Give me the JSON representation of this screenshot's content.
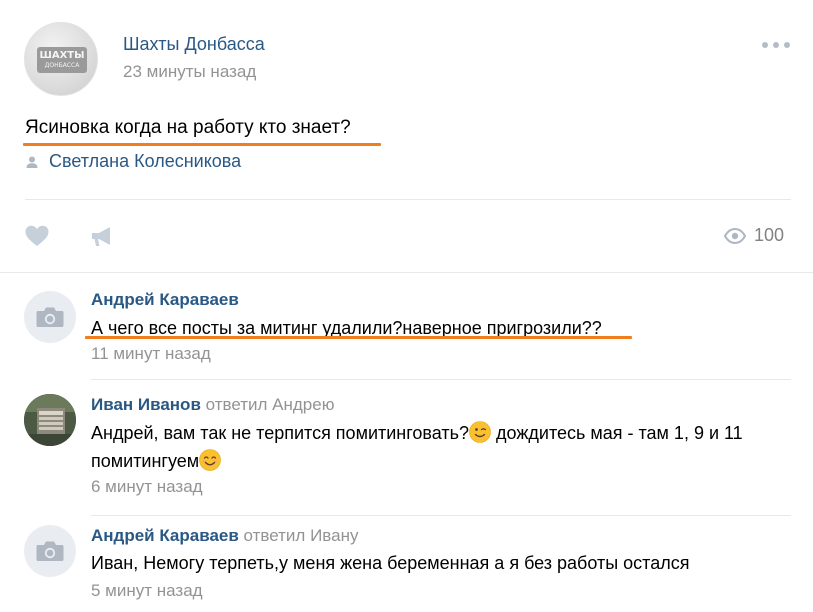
{
  "post": {
    "group_name": "Шахты Донбасса",
    "time": "23 минуты назад",
    "avatar_text_line1": "ШАХТЫ",
    "avatar_text_line2": "ДОНБАССА",
    "text": "Ясиновка когда на работу кто знает?",
    "signer": "Светлана Колесникова",
    "views": "100",
    "icons": {
      "more": "more-dots-icon",
      "signer": "user-icon",
      "like": "heart-icon",
      "share": "megaphone-icon",
      "views": "eye-icon"
    }
  },
  "comments": [
    {
      "author": "Андрей Караваев",
      "reply_to": "",
      "text": "А чего все посты за митинг удалили?наверное пригрозили??",
      "time": "11 минут назад",
      "avatar": "camera-icon"
    },
    {
      "author": "Иван Иванов",
      "reply_to": "ответил Андрею",
      "text_part1": "Андрей, вам так не терпится помитинговать?",
      "text_part2": " дождитесь мая - там 1, 9 и 11 помитингуем",
      "time": "6 минут назад",
      "avatar": "user-photo",
      "emojis": [
        "wink-emoji",
        "smile-emoji"
      ]
    },
    {
      "author": "Андрей Караваев",
      "reply_to": "ответил Ивану",
      "text": "Иван, Немогу терпеть,у меня жена беременная а я без работы остался",
      "time": "5 минут назад",
      "avatar": "camera-icon"
    }
  ],
  "colors": {
    "link": "#2a5885",
    "muted": "#939393",
    "highlight_underline": "#f07d1e",
    "divider": "#e7e8ec"
  }
}
